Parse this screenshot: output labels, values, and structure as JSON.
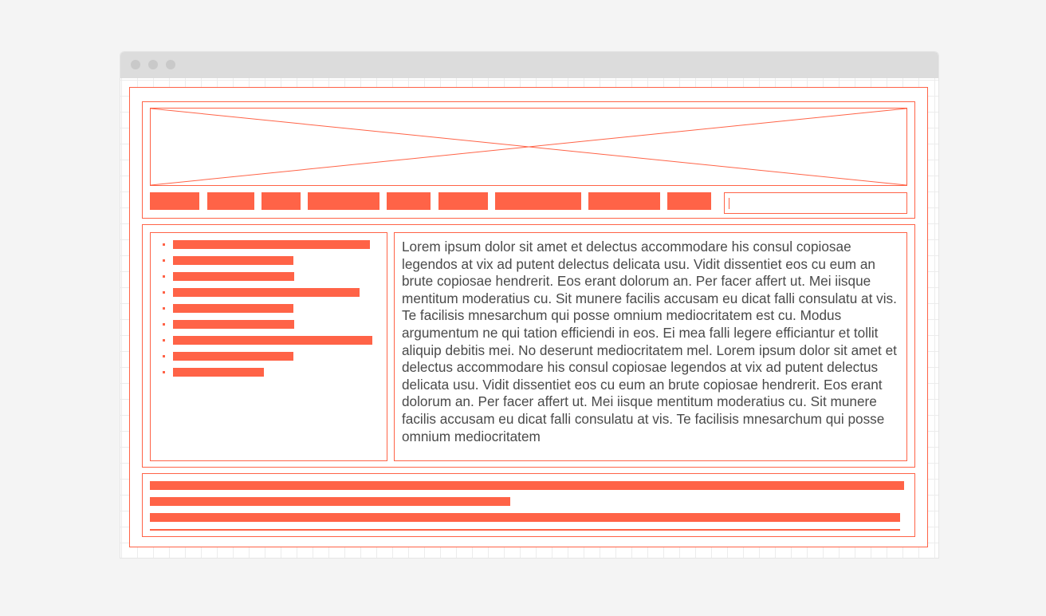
{
  "theme": {
    "accent": "#ff6347",
    "background": "#f4f4f4",
    "titlebar": "#dcdcdc",
    "text": "#4a4a4a"
  },
  "window": {
    "controls": [
      "close-dot",
      "minimize-dot",
      "maximize-dot"
    ]
  },
  "header": {
    "banner_image": "image-placeholder",
    "nav_items": 9,
    "search": {
      "value": ""
    }
  },
  "sidebar": {
    "list_items": 9
  },
  "content": {
    "paragraph": "Lorem ipsum dolor sit amet et delectus accommodare his consul copiosae legendos at vix ad putent delectus delicata usu. Vidit dissentiet eos cu eum an brute copiosae hendrerit. Eos erant dolorum an. Per facer affert ut. Mei iisque mentitum moderatius cu. Sit munere facilis accusam eu dicat falli consulatu at vis. Te facilisis mnesarchum qui posse omnium mediocritatem est cu. Modus argumentum ne qui tation efficiendi in eos. Ei mea falli legere efficiantur et tollit aliquip debitis mei. No deserunt mediocritatem mel. Lorem ipsum dolor sit amet et delectus accommodare his consul copiosae legendos at vix ad putent delectus delicata usu. Vidit dissentiet eos cu eum an brute copiosae hendrerit. Eos erant dolorum an. Per facer affert ut. Mei iisque mentitum moderatius cu. Sit munere facilis accusam eu dicat falli consulatu at vis. Te facilisis mnesarchum qui posse omnium mediocritatem"
  },
  "footer": {
    "text_lines": 3
  }
}
